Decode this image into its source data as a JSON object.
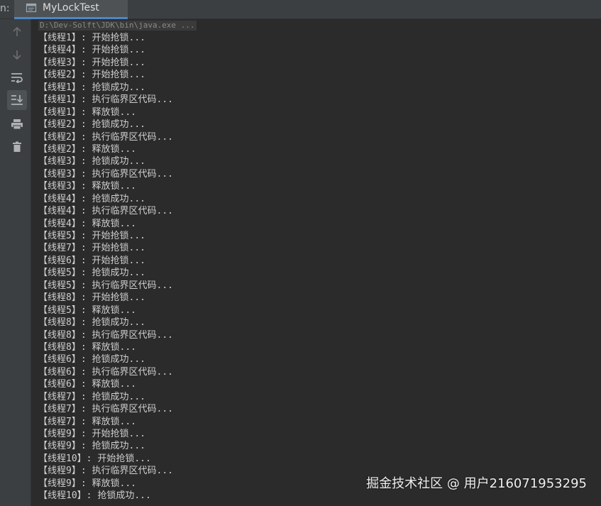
{
  "run_label": "n:",
  "tab": {
    "title": "MyLockTest",
    "icon": "console-window-icon"
  },
  "toolbar": [
    {
      "name": "up-arrow-icon",
      "active": false
    },
    {
      "name": "down-arrow-icon",
      "active": false
    },
    {
      "name": "soft-wrap-icon",
      "active": false
    },
    {
      "name": "scroll-to-end-icon",
      "active": true
    },
    {
      "name": "print-icon",
      "active": false
    },
    {
      "name": "trash-icon",
      "active": false
    }
  ],
  "console": {
    "command": "D:\\Dev-Solft\\JDK\\bin\\java.exe ...",
    "lines": [
      {
        "thread": "线程1",
        "msg": "开始抢锁..."
      },
      {
        "thread": "线程4",
        "msg": "开始抢锁..."
      },
      {
        "thread": "线程3",
        "msg": "开始抢锁..."
      },
      {
        "thread": "线程2",
        "msg": "开始抢锁..."
      },
      {
        "thread": "线程1",
        "msg": "抢锁成功..."
      },
      {
        "thread": "线程1",
        "msg": "执行临界区代码..."
      },
      {
        "thread": "线程1",
        "msg": "释放锁..."
      },
      {
        "thread": "线程2",
        "msg": "抢锁成功..."
      },
      {
        "thread": "线程2",
        "msg": "执行临界区代码..."
      },
      {
        "thread": "线程2",
        "msg": "释放锁..."
      },
      {
        "thread": "线程3",
        "msg": "抢锁成功..."
      },
      {
        "thread": "线程3",
        "msg": "执行临界区代码..."
      },
      {
        "thread": "线程3",
        "msg": "释放锁..."
      },
      {
        "thread": "线程4",
        "msg": "抢锁成功..."
      },
      {
        "thread": "线程4",
        "msg": "执行临界区代码..."
      },
      {
        "thread": "线程4",
        "msg": "释放锁..."
      },
      {
        "thread": "线程5",
        "msg": "开始抢锁..."
      },
      {
        "thread": "线程7",
        "msg": "开始抢锁..."
      },
      {
        "thread": "线程6",
        "msg": "开始抢锁..."
      },
      {
        "thread": "线程5",
        "msg": "抢锁成功..."
      },
      {
        "thread": "线程5",
        "msg": "执行临界区代码..."
      },
      {
        "thread": "线程8",
        "msg": "开始抢锁..."
      },
      {
        "thread": "线程5",
        "msg": "释放锁..."
      },
      {
        "thread": "线程8",
        "msg": "抢锁成功..."
      },
      {
        "thread": "线程8",
        "msg": "执行临界区代码..."
      },
      {
        "thread": "线程8",
        "msg": "释放锁..."
      },
      {
        "thread": "线程6",
        "msg": "抢锁成功..."
      },
      {
        "thread": "线程6",
        "msg": "执行临界区代码..."
      },
      {
        "thread": "线程6",
        "msg": "释放锁..."
      },
      {
        "thread": "线程7",
        "msg": "抢锁成功..."
      },
      {
        "thread": "线程7",
        "msg": "执行临界区代码..."
      },
      {
        "thread": "线程7",
        "msg": "释放锁..."
      },
      {
        "thread": "线程9",
        "msg": "开始抢锁..."
      },
      {
        "thread": "线程9",
        "msg": "抢锁成功..."
      },
      {
        "thread": "线程10",
        "msg": "开始抢锁..."
      },
      {
        "thread": "线程9",
        "msg": "执行临界区代码..."
      },
      {
        "thread": "线程9",
        "msg": "释放锁..."
      },
      {
        "thread": "线程10",
        "msg": "抢锁成功..."
      }
    ]
  },
  "watermark": "掘金技术社区 @ 用户216071953295",
  "colors": {
    "background": "#2b2b2b",
    "panel": "#3c3f41",
    "tab_accent": "#4a88c7",
    "text": "#cfcfcf"
  }
}
